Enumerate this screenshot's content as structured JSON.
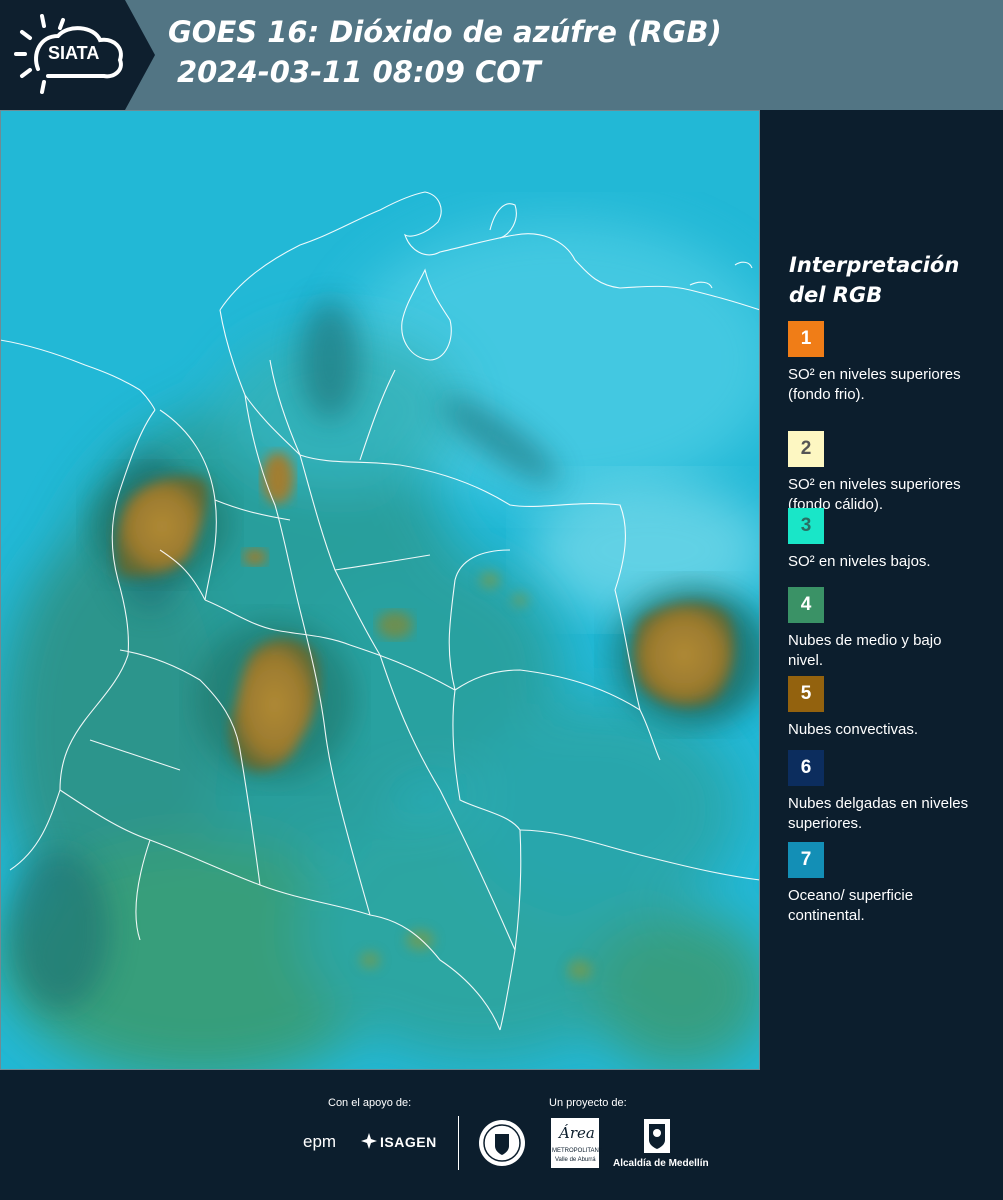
{
  "header": {
    "logo_text": "SIATA",
    "title_line1": "GOES 16: Dióxido de azúfre (RGB)",
    "title_line2": "2024-03-11 08:09 COT"
  },
  "legend": {
    "title": "Interpretación del RGB",
    "items": [
      {
        "number": "1",
        "label": "SO² en niveles superiores (fondo frio).",
        "color": "#f07d17",
        "text_color": "#ffffff"
      },
      {
        "number": "2",
        "label": "SO² en niveles superiores (fondo cálido).",
        "color": "#fdf7c2",
        "text_color": "#555555"
      },
      {
        "number": "3",
        "label": "SO² en niveles bajos.",
        "color": "#19e6c8",
        "text_color": "#2a6e63"
      },
      {
        "number": "4",
        "label": "Nubes de medio y bajo nivel.",
        "color": "#3a9266",
        "text_color": "#ffffff"
      },
      {
        "number": "5",
        "label": "Nubes convectivas.",
        "color": "#93620e",
        "text_color": "#ffffff"
      },
      {
        "number": "6",
        "label": "Nubes delgadas en niveles superiores.",
        "color": "#0c2d5e",
        "text_color": "#ffffff"
      },
      {
        "number": "7",
        "label": "Oceano/ superficie continental.",
        "color": "#138fb6",
        "text_color": "#ffffff"
      }
    ]
  },
  "footer": {
    "support_caption": "Con el apoyo de:",
    "project_caption": "Un proyecto de:",
    "sponsors": [
      "epm",
      "ISAGEN"
    ],
    "partners": [
      "Área Metropolitana Valle de Aburrá",
      "Alcaldía de Medellín"
    ],
    "epm_text": "epm",
    "isagen_text": "ISAGEN",
    "area_text": "Área",
    "area_sub": "METROPOLITANA",
    "area_sub2": "Valle de Aburrá",
    "alcaldia_text": "Alcaldía de Medellín"
  },
  "colors": {
    "header_bg": "#527584",
    "panel_bg": "#0c1e2d",
    "ocean": "#22b8d6",
    "land": "#2ea39d",
    "convective": "#9b7a2e",
    "border": "#ffffff"
  }
}
